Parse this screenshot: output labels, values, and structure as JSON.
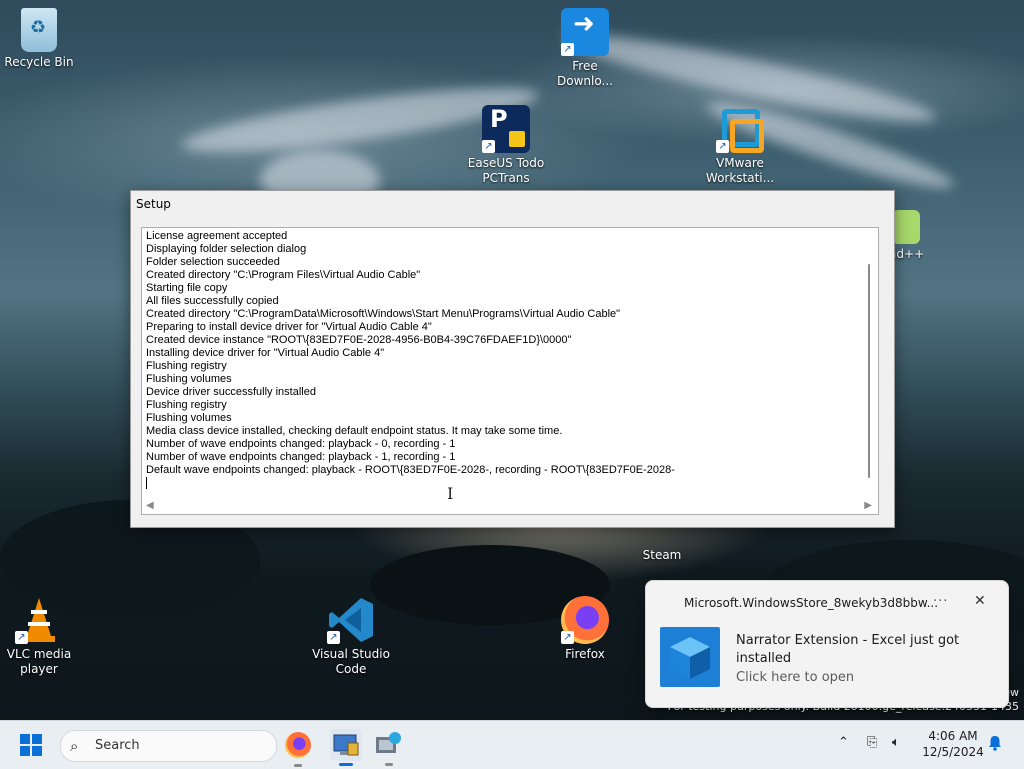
{
  "desktop": {
    "icons": [
      {
        "label": "Recycle Bin"
      },
      {
        "label": "Free Downlo..."
      },
      {
        "label": "EaseUS Todo PCTrans"
      },
      {
        "label": "VMware Workstati..."
      },
      {
        "label": "...pad++"
      },
      {
        "label": "Steam"
      },
      {
        "label": "VLC media player"
      },
      {
        "label": "Visual Studio Code"
      },
      {
        "label": "Firefox"
      }
    ]
  },
  "setup_window": {
    "title": "Setup",
    "log": [
      "License agreement accepted",
      "Displaying folder selection dialog",
      "Folder selection succeeded",
      "Created directory \"C:\\Program Files\\Virtual Audio Cable\"",
      "Starting file copy",
      "All files successfully copied",
      "Created directory \"C:\\ProgramData\\Microsoft\\Windows\\Start Menu\\Programs\\Virtual Audio Cable\"",
      "Preparing to install device driver for \"Virtual Audio Cable 4\"",
      "Created device instance \"ROOT\\{83ED7F0E-2028-4956-B0B4-39C76FDAEF1D}\\0000\"",
      "Installing device driver for \"Virtual Audio Cable 4\"",
      "Flushing registry",
      "Flushing volumes",
      "Device driver successfully installed",
      "Flushing registry",
      "Flushing volumes",
      "Media class device installed, checking default endpoint status. It may take some time.",
      "Number of wave endpoints changed: playback - 0, recording - 1",
      "Number of wave endpoints changed: playback - 1, recording - 1",
      "Default wave endpoints changed: playback - ROOT\\{83ED7F0E-2028-, recording - ROOT\\{83ED7F0E-2028-"
    ]
  },
  "toast": {
    "app_name": "Microsoft.WindowsStore_8wekyb3d8bbw...",
    "more_label": "···",
    "close_label": "✕",
    "title": "Narrator Extension - Excel just got installed",
    "subtitle": "Click here to open"
  },
  "watermark": {
    "line1": "ew",
    "line2": "For testing purposes only. Build 26100.ge_release.240331-1435"
  },
  "taskbar": {
    "search_placeholder": "Search",
    "time": "4:06 AM",
    "date": "12/5/2024"
  },
  "colors": {
    "accent": "#0a6fd6",
    "taskbar_bg": "#e9eef3",
    "toast_bg": "#f3f3f3"
  }
}
